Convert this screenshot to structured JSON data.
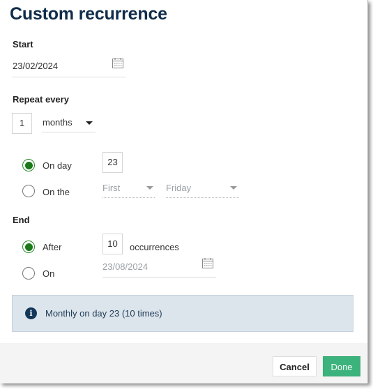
{
  "dialog": {
    "title": "Custom recurrence",
    "start": {
      "label": "Start",
      "value": "23/02/2024",
      "icon": "calendar-icon"
    },
    "repeat": {
      "label": "Repeat every",
      "interval": "1",
      "unit": "months",
      "options": [
        {
          "label": "On day",
          "selected": true,
          "day": "23"
        },
        {
          "label": "On the",
          "selected": false,
          "ordinal": "First",
          "weekday": "Friday"
        }
      ]
    },
    "end": {
      "label": "End",
      "options": [
        {
          "label": "After",
          "selected": true,
          "count": "10",
          "suffix": "occurrences"
        },
        {
          "label": "On",
          "selected": false,
          "date": "23/08/2024"
        }
      ]
    },
    "summary": {
      "icon": "info-icon",
      "icon_glyph": "i",
      "text": "Monthly on day 23 (10 times)"
    },
    "buttons": {
      "cancel": "Cancel",
      "done": "Done"
    }
  },
  "colors": {
    "title": "#0f2d4a",
    "radio_checked": "#1a7a1a",
    "info_bg": "#dde5ec",
    "done_button": "#3cb37c"
  }
}
